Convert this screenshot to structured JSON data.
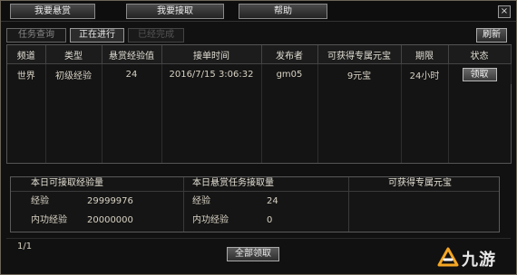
{
  "top_menu": [
    {
      "label": "我要悬赏"
    },
    {
      "label": "我要接取"
    },
    {
      "label": "帮助"
    }
  ],
  "close_label": "×",
  "tabs": [
    {
      "label": "任务查询",
      "state": "normal"
    },
    {
      "label": "正在进行",
      "state": "active"
    },
    {
      "label": "已经完成",
      "state": "disabled"
    }
  ],
  "refresh_label": "刷新",
  "table": {
    "headers": [
      "频道",
      "类型",
      "悬赏经验值",
      "接单时间",
      "发布者",
      "可获得专属元宝",
      "期限",
      "状态"
    ],
    "rows": [
      {
        "channel": "世界",
        "type": "初级经验",
        "reward_exp": "24",
        "accept_time": "2016/7/15 3:06:32",
        "publisher": "gm05",
        "yuanbao": "9元宝",
        "deadline": "24小时",
        "status_button": "领取"
      }
    ]
  },
  "summary": {
    "col1_header": "本日可接取经验量",
    "col2_header": "本日悬赏任务接取量",
    "col3_header": "可获得专属元宝",
    "col1_rows": [
      {
        "label": "经验",
        "value": "29999976"
      },
      {
        "label": "内功经验",
        "value": "20000000"
      }
    ],
    "col2_rows": [
      {
        "label": "经验",
        "value": "24"
      },
      {
        "label": "内功经验",
        "value": "0"
      }
    ]
  },
  "pagination": "1/1",
  "claim_all_label": "全部领取",
  "watermark_text": "九游",
  "colors": {
    "background": "#111111",
    "border": "#6b6458",
    "text": "#d8d2c4",
    "logo_orange": "#f5a623"
  }
}
